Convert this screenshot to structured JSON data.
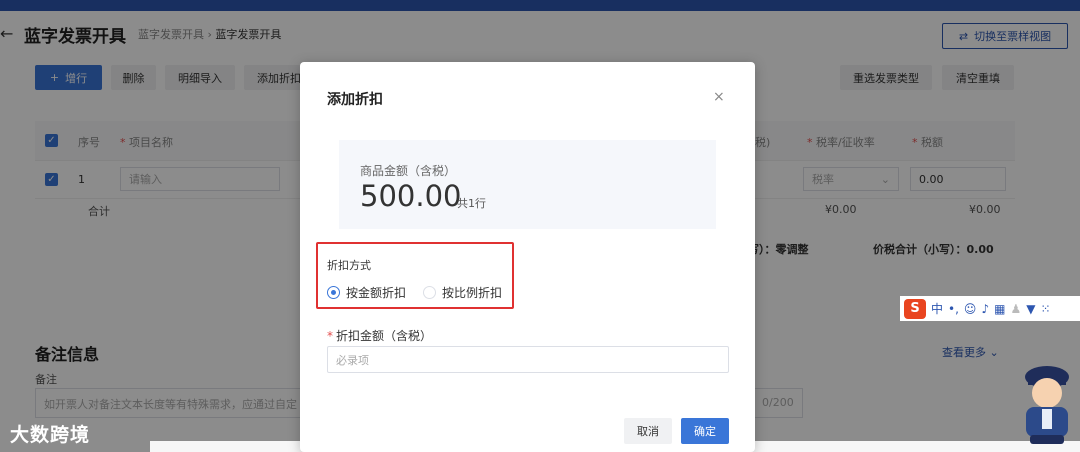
{
  "header": {
    "back_icon": "arrow-left-icon",
    "title": "蓝字发票开具",
    "breadcrumb": [
      "蓝字发票开具",
      "蓝字发票开具"
    ],
    "switch_label": "切换至票样视图"
  },
  "toolbar": {
    "add_row": "增行",
    "delete": "删除",
    "import": "明细导入",
    "add_discount": "添加折扣",
    "reselect": "重选发票类型",
    "clear": "清空重填"
  },
  "table": {
    "headers": {
      "index": "序号",
      "item_name": "项目名称",
      "tax_rate": "税率/征收率",
      "tax_amount": "税额",
      "partial": "税)"
    },
    "row": {
      "index": "1",
      "name_placeholder": "请输入",
      "rate_placeholder": "税率",
      "tax_value": "0.00"
    },
    "subtotal_label": "合计",
    "subtotal_a": "¥0.00",
    "subtotal_b": "¥0.00",
    "adjust": "写）：零调整",
    "total_label": "价税合计（小写）：0.00"
  },
  "remark": {
    "title": "备注信息",
    "label": "备注",
    "placeholder": "如开票人对备注文本长度等有特殊需求，应通过自定",
    "counter": "0/200",
    "more": "查看更多"
  },
  "modal": {
    "title": "添加折扣",
    "amount_label": "商品金额（含税）",
    "amount_value": "500.00",
    "amount_rows": "共1行",
    "method_label": "折扣方式",
    "option_amount": "按金额折扣",
    "option_ratio": "按比例折扣",
    "discount_label": "折扣金额（含税）",
    "discount_placeholder": "必录项",
    "cancel": "取消",
    "confirm": "确定"
  },
  "ime": {
    "label": "中"
  },
  "watermark": "大数跨境",
  "colors": {
    "primary": "#3a76d8",
    "highlight": "#e03131",
    "topbar": "#2d56b0"
  }
}
